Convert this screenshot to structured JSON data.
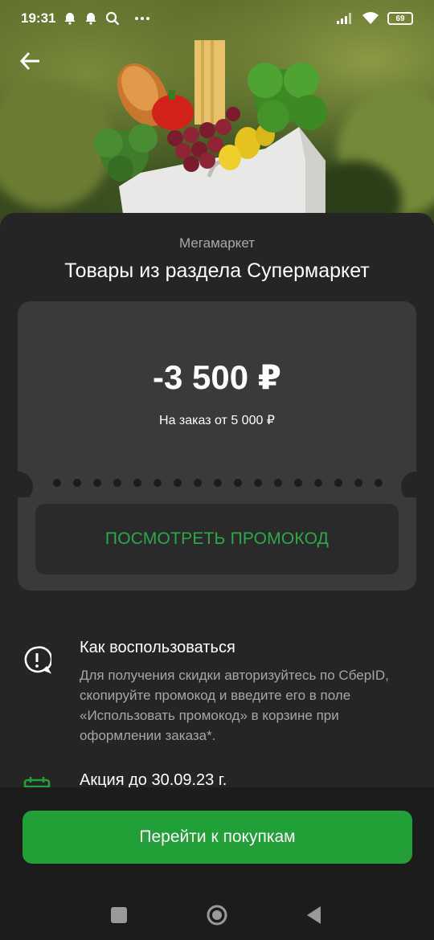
{
  "status_bar": {
    "time": "19:31",
    "battery": "69",
    "icons": [
      "alarm-icon",
      "alarm-icon",
      "search-icon",
      "more-icon",
      "signal-icon",
      "wifi-icon",
      "battery-icon"
    ]
  },
  "header": {
    "back_icon": "arrow-left-icon"
  },
  "offer": {
    "subtitle": "Мегамаркет",
    "title": "Товары из раздела Супермаркет",
    "amount": "-3 500 ₽",
    "condition": "На заказ от 5 000 ₽",
    "promo_button": "ПОСМОТРЕТЬ ПРОМОКОД"
  },
  "how_to_use": {
    "heading": "Как воспользоваться",
    "text": "Для получения скидки авторизуйтесь по СберID, скопируйте промокод и введите его в поле «Использовать промокод» в корзине при оформлении заказа*.",
    "icon": "alert-circle-icon"
  },
  "promo_period": {
    "heading": "Акция до 30.09.23 г.",
    "icon": "calendar-icon"
  },
  "cta": {
    "label": "Перейти к покупкам"
  },
  "colors": {
    "accent_green": "#21a038",
    "promo_text_green": "#2da84a",
    "sheet_bg": "#252525",
    "card_bg": "#3a3a3a"
  }
}
